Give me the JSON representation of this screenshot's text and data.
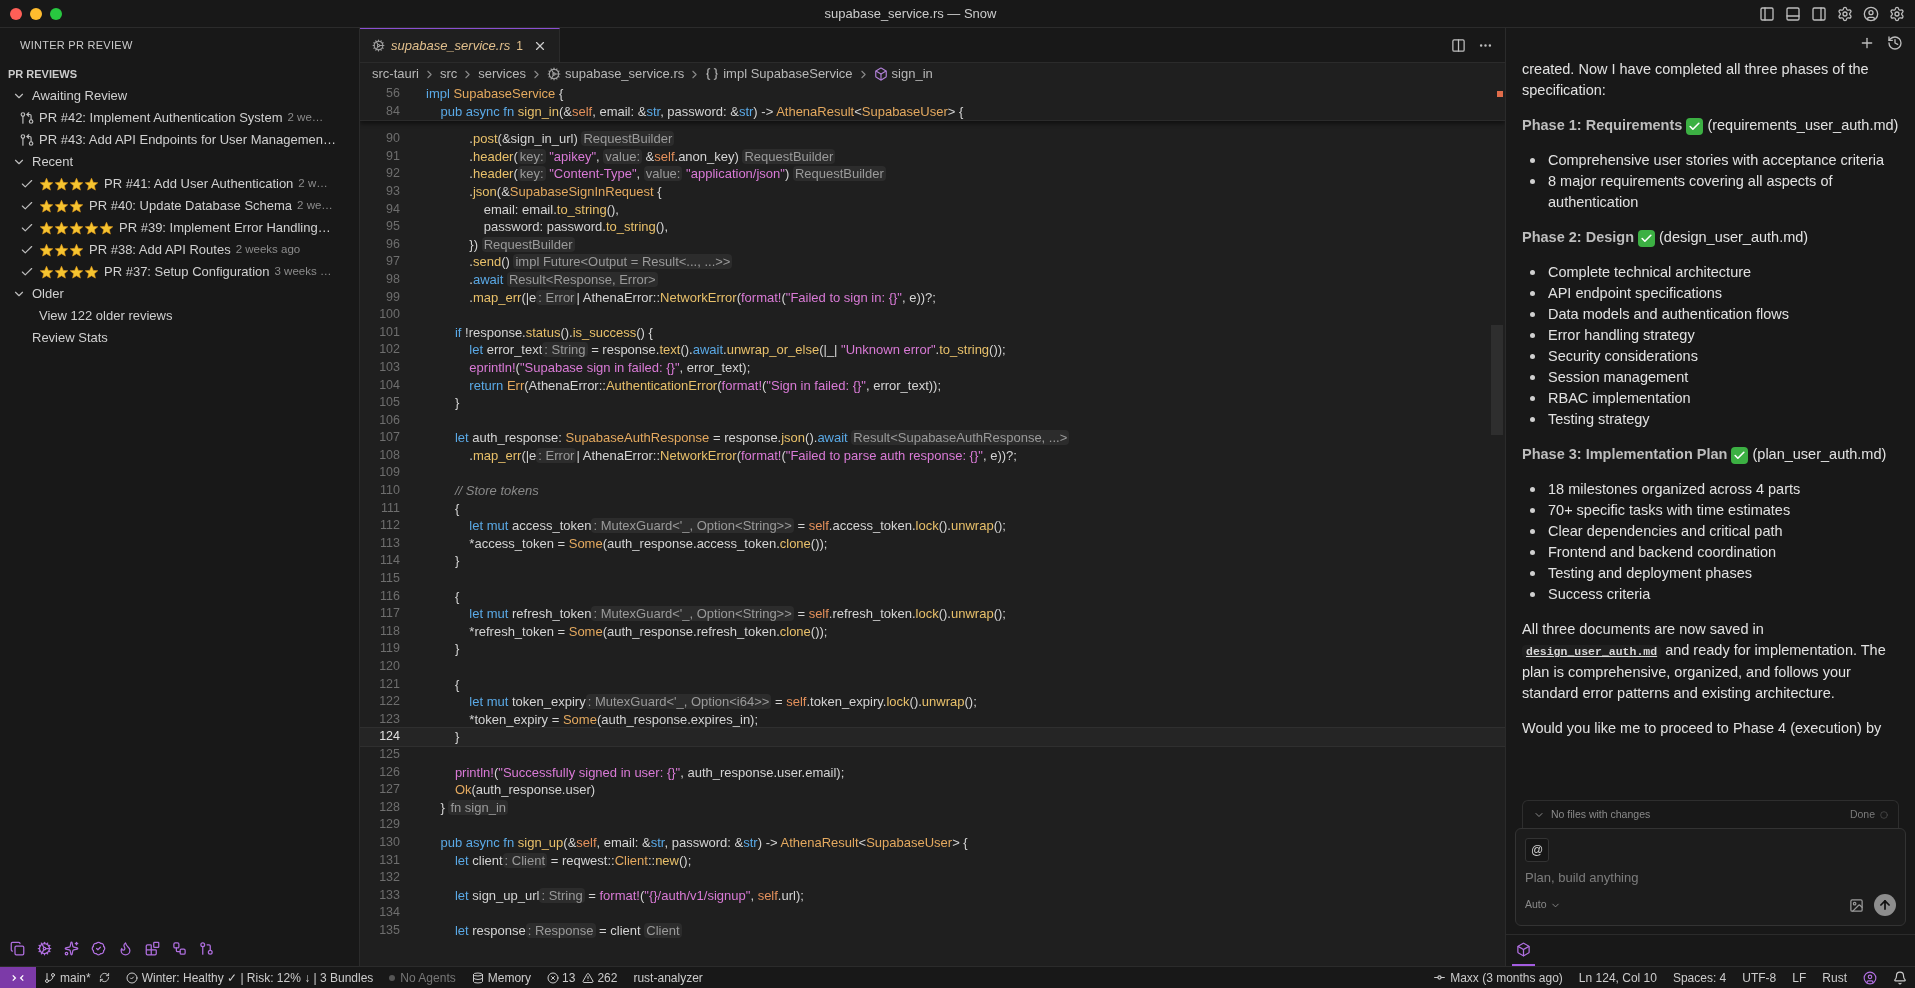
{
  "window": {
    "title": "supabase_service.rs — Snow"
  },
  "sidebar": {
    "title": "WINTER PR REVIEW",
    "section": "PR REVIEWS",
    "groups": [
      {
        "label": "Awaiting Review",
        "expanded": true,
        "children": [
          {
            "kind": "pr",
            "title": "PR #42: Implement Authentication System",
            "age": "2 we…"
          },
          {
            "kind": "pr",
            "title": "PR #43: Add API Endpoints for User Managemen…"
          }
        ]
      },
      {
        "label": "Recent",
        "expanded": true,
        "children": [
          {
            "kind": "rated",
            "stars": 4,
            "title": "PR #41: Add User Authentication",
            "age": "2 w…"
          },
          {
            "kind": "rated",
            "stars": 3,
            "title": "PR #40: Update Database Schema",
            "age": "2 we…"
          },
          {
            "kind": "rated",
            "stars": 5,
            "title": "PR #39: Implement Error Handling…"
          },
          {
            "kind": "rated",
            "stars": 3,
            "title": "PR #38: Add API Routes",
            "age": "2 weeks ago"
          },
          {
            "kind": "rated",
            "stars": 4,
            "title": "PR #37: Setup Configuration",
            "age": "3 weeks …"
          }
        ]
      },
      {
        "label": "Older",
        "expanded": true,
        "children": [
          {
            "kind": "link",
            "title": "View 122 older reviews"
          }
        ]
      }
    ],
    "footer_item": "Review Stats"
  },
  "tab": {
    "name": "supabase_service.rs",
    "problems": "1",
    "selected": true
  },
  "breadcrumbs": [
    {
      "kind": "folder",
      "label": "src-tauri"
    },
    {
      "kind": "folder",
      "label": "src"
    },
    {
      "kind": "folder",
      "label": "services"
    },
    {
      "kind": "file",
      "label": "supabase_service.rs"
    },
    {
      "kind": "impl",
      "label": "impl SupabaseService"
    },
    {
      "kind": "method",
      "label": "sign_in"
    }
  ],
  "code": {
    "sticky_lines": [
      {
        "number": "56",
        "current": false,
        "tokens": [
          {
            "text": "impl ",
            "kind": "kw"
          },
          {
            "text": "SupabaseService ",
            "kind": "ty"
          },
          {
            "text": "{",
            "kind": "p"
          }
        ]
      },
      {
        "number": "84",
        "current": false,
        "tokens": [
          {
            "text": "    pub async fn ",
            "kind": "kw"
          },
          {
            "text": "sign_in",
            "kind": "fn"
          },
          {
            "text": "(&",
            "kind": "p"
          },
          {
            "text": "self",
            "kind": "self"
          },
          {
            "text": ", email: &",
            "kind": "p"
          },
          {
            "text": "str",
            "kind": "kw"
          },
          {
            "text": ", password: &",
            "kind": "p"
          },
          {
            "text": "str",
            "kind": "kw"
          },
          {
            "text": ") -> ",
            "kind": "p"
          },
          {
            "text": "AthenaResult",
            "kind": "ty"
          },
          {
            "text": "<",
            "kind": "p"
          },
          {
            "text": "SupabaseUser",
            "kind": "ty"
          },
          {
            "text": "> {",
            "kind": "p"
          }
        ]
      }
    ],
    "lines": [
      {
        "number": "90",
        "current": false,
        "tokens": [
          {
            "text": "            .",
            "kind": "p"
          },
          {
            "text": "post",
            "kind": "fn"
          },
          {
            "text": "(&sign_in_url) ",
            "kind": "p"
          },
          {
            "text": "RequestBuilder",
            "kind": "hint"
          }
        ]
      },
      {
        "number": "91",
        "current": false,
        "tokens": [
          {
            "text": "            .",
            "kind": "p"
          },
          {
            "text": "header",
            "kind": "fn"
          },
          {
            "text": "(",
            "kind": "p"
          },
          {
            "text": "key:",
            "kind": "hint"
          },
          {
            "text": " \"apikey\"",
            "kind": "str"
          },
          {
            "text": ", ",
            "kind": "p"
          },
          {
            "text": "value:",
            "kind": "hint"
          },
          {
            "text": " &",
            "kind": "p"
          },
          {
            "text": "self",
            "kind": "self"
          },
          {
            "text": ".anon_key) ",
            "kind": "p"
          },
          {
            "text": "RequestBuilder",
            "kind": "hint"
          }
        ]
      },
      {
        "number": "92",
        "current": false,
        "tokens": [
          {
            "text": "            .",
            "kind": "p"
          },
          {
            "text": "header",
            "kind": "fn"
          },
          {
            "text": "(",
            "kind": "p"
          },
          {
            "text": "key:",
            "kind": "hint"
          },
          {
            "text": " \"Content-Type\"",
            "kind": "str"
          },
          {
            "text": ", ",
            "kind": "p"
          },
          {
            "text": "value:",
            "kind": "hint"
          },
          {
            "text": " \"application/json\"",
            "kind": "str"
          },
          {
            "text": ") ",
            "kind": "p"
          },
          {
            "text": "RequestBuilder",
            "kind": "hint"
          }
        ]
      },
      {
        "number": "93",
        "current": false,
        "tokens": [
          {
            "text": "            .",
            "kind": "p"
          },
          {
            "text": "json",
            "kind": "fn"
          },
          {
            "text": "(&",
            "kind": "p"
          },
          {
            "text": "SupabaseSignInRequest",
            "kind": "ty"
          },
          {
            "text": " {",
            "kind": "p"
          }
        ]
      },
      {
        "number": "94",
        "current": false,
        "tokens": [
          {
            "text": "                email: email.",
            "kind": "p"
          },
          {
            "text": "to_string",
            "kind": "fn"
          },
          {
            "text": "(),",
            "kind": "p"
          }
        ]
      },
      {
        "number": "95",
        "current": false,
        "tokens": [
          {
            "text": "                password: password.",
            "kind": "p"
          },
          {
            "text": "to_string",
            "kind": "fn"
          },
          {
            "text": "(),",
            "kind": "p"
          }
        ]
      },
      {
        "number": "96",
        "current": false,
        "tokens": [
          {
            "text": "            }) ",
            "kind": "p"
          },
          {
            "text": "RequestBuilder",
            "kind": "hint"
          }
        ]
      },
      {
        "number": "97",
        "current": false,
        "tokens": [
          {
            "text": "            .",
            "kind": "p"
          },
          {
            "text": "send",
            "kind": "fn"
          },
          {
            "text": "() ",
            "kind": "p"
          },
          {
            "text": "impl Future<Output = Result<..., ...>>",
            "kind": "hint"
          }
        ]
      },
      {
        "number": "98",
        "current": false,
        "tokens": [
          {
            "text": "            .",
            "kind": "p"
          },
          {
            "text": "await ",
            "kind": "kw"
          },
          {
            "text": "Result<Response, Error>",
            "kind": "hint"
          }
        ]
      },
      {
        "number": "99",
        "current": false,
        "tokens": [
          {
            "text": "            .",
            "kind": "p"
          },
          {
            "text": "map_err",
            "kind": "fn"
          },
          {
            "text": "(|e",
            "kind": "p"
          },
          {
            "text": ": Error",
            "kind": "hint"
          },
          {
            "text": "| AthenaError::",
            "kind": "p"
          },
          {
            "text": "NetworkError",
            "kind": "fn"
          },
          {
            "text": "(",
            "kind": "p"
          },
          {
            "text": "format!",
            "kind": "mac"
          },
          {
            "text": "(",
            "kind": "p"
          },
          {
            "text": "\"Failed to sign in: {}\"",
            "kind": "str"
          },
          {
            "text": ", e))?;",
            "kind": "p"
          }
        ]
      },
      {
        "number": "100",
        "current": false
      },
      {
        "number": "101",
        "current": false,
        "tokens": [
          {
            "text": "        if ",
            "kind": "kw"
          },
          {
            "text": "!response.",
            "kind": "p"
          },
          {
            "text": "status",
            "kind": "fn"
          },
          {
            "text": "().",
            "kind": "p"
          },
          {
            "text": "is_success",
            "kind": "fn"
          },
          {
            "text": "() {",
            "kind": "p"
          }
        ]
      },
      {
        "number": "102",
        "current": false,
        "tokens": [
          {
            "text": "            let ",
            "kind": "kw"
          },
          {
            "text": "error_text",
            "kind": "p"
          },
          {
            "text": ": String",
            "kind": "hint"
          },
          {
            "text": " = response.",
            "kind": "p"
          },
          {
            "text": "text",
            "kind": "fn"
          },
          {
            "text": "().",
            "kind": "p"
          },
          {
            "text": "await",
            "kind": "kw"
          },
          {
            "text": ".",
            "kind": "p"
          },
          {
            "text": "unwrap_or_else",
            "kind": "fn"
          },
          {
            "text": "(|_| ",
            "kind": "p"
          },
          {
            "text": "\"Unknown error\"",
            "kind": "str"
          },
          {
            "text": ".",
            "kind": "p"
          },
          {
            "text": "to_string",
            "kind": "fn"
          },
          {
            "text": "());",
            "kind": "p"
          }
        ]
      },
      {
        "number": "103",
        "current": false,
        "tokens": [
          {
            "text": "            eprintln!",
            "kind": "mac"
          },
          {
            "text": "(",
            "kind": "p"
          },
          {
            "text": "\"Supabase sign in failed: {}\"",
            "kind": "str"
          },
          {
            "text": ", error_text);",
            "kind": "p"
          }
        ]
      },
      {
        "number": "104",
        "current": false,
        "tokens": [
          {
            "text": "            return ",
            "kind": "kw"
          },
          {
            "text": "Err",
            "kind": "ty"
          },
          {
            "text": "(AthenaError::",
            "kind": "p"
          },
          {
            "text": "AuthenticationError",
            "kind": "fn"
          },
          {
            "text": "(",
            "kind": "p"
          },
          {
            "text": "format!",
            "kind": "mac"
          },
          {
            "text": "(",
            "kind": "p"
          },
          {
            "text": "\"Sign in failed: {}\"",
            "kind": "str"
          },
          {
            "text": ", error_text));",
            "kind": "p"
          }
        ]
      },
      {
        "number": "105",
        "current": false,
        "tokens": [
          {
            "text": "        }",
            "kind": "p"
          }
        ]
      },
      {
        "number": "106",
        "current": false
      },
      {
        "number": "107",
        "current": false,
        "tokens": [
          {
            "text": "        let ",
            "kind": "kw"
          },
          {
            "text": "auth_response: ",
            "kind": "p"
          },
          {
            "text": "SupabaseAuthResponse",
            "kind": "ty"
          },
          {
            "text": " = response.",
            "kind": "p"
          },
          {
            "text": "json",
            "kind": "fn"
          },
          {
            "text": "().",
            "kind": "p"
          },
          {
            "text": "await ",
            "kind": "kw"
          },
          {
            "text": "Result<SupabaseAuthResponse, ...>",
            "kind": "hint"
          }
        ]
      },
      {
        "number": "108",
        "current": false,
        "tokens": [
          {
            "text": "            .",
            "kind": "p"
          },
          {
            "text": "map_err",
            "kind": "fn"
          },
          {
            "text": "(|e",
            "kind": "p"
          },
          {
            "text": ": Error",
            "kind": "hint"
          },
          {
            "text": "| AthenaError::",
            "kind": "p"
          },
          {
            "text": "NetworkError",
            "kind": "fn"
          },
          {
            "text": "(",
            "kind": "p"
          },
          {
            "text": "format!",
            "kind": "mac"
          },
          {
            "text": "(",
            "kind": "p"
          },
          {
            "text": "\"Failed to parse auth response: {}\"",
            "kind": "str"
          },
          {
            "text": ", e))?;",
            "kind": "p"
          }
        ]
      },
      {
        "number": "109",
        "current": false
      },
      {
        "number": "110",
        "current": false,
        "tokens": [
          {
            "text": "        // Store tokens",
            "kind": "cm"
          }
        ]
      },
      {
        "number": "111",
        "current": false,
        "tokens": [
          {
            "text": "        {",
            "kind": "p"
          }
        ]
      },
      {
        "number": "112",
        "current": false,
        "tokens": [
          {
            "text": "            let mut ",
            "kind": "kw"
          },
          {
            "text": "access_token",
            "kind": "p"
          },
          {
            "text": ": MutexGuard<'_, Option<String>>",
            "kind": "hint"
          },
          {
            "text": " = ",
            "kind": "p"
          },
          {
            "text": "self",
            "kind": "self"
          },
          {
            "text": ".access_token.",
            "kind": "p"
          },
          {
            "text": "lock",
            "kind": "fn"
          },
          {
            "text": "().",
            "kind": "p"
          },
          {
            "text": "unwrap",
            "kind": "fn"
          },
          {
            "text": "();",
            "kind": "p"
          }
        ]
      },
      {
        "number": "113",
        "current": false,
        "tokens": [
          {
            "text": "            *access_token = ",
            "kind": "p"
          },
          {
            "text": "Some",
            "kind": "ty"
          },
          {
            "text": "(auth_response.access_token.",
            "kind": "p"
          },
          {
            "text": "clone",
            "kind": "fn"
          },
          {
            "text": "());",
            "kind": "p"
          }
        ]
      },
      {
        "number": "114",
        "current": false,
        "tokens": [
          {
            "text": "        }",
            "kind": "p"
          }
        ]
      },
      {
        "number": "115",
        "current": false
      },
      {
        "number": "116",
        "current": false,
        "tokens": [
          {
            "text": "        {",
            "kind": "p"
          }
        ]
      },
      {
        "number": "117",
        "current": false,
        "tokens": [
          {
            "text": "            let mut ",
            "kind": "kw"
          },
          {
            "text": "refresh_token",
            "kind": "p"
          },
          {
            "text": ": MutexGuard<'_, Option<String>>",
            "kind": "hint"
          },
          {
            "text": " = ",
            "kind": "p"
          },
          {
            "text": "self",
            "kind": "self"
          },
          {
            "text": ".refresh_token.",
            "kind": "p"
          },
          {
            "text": "lock",
            "kind": "fn"
          },
          {
            "text": "().",
            "kind": "p"
          },
          {
            "text": "unwrap",
            "kind": "fn"
          },
          {
            "text": "();",
            "kind": "p"
          }
        ]
      },
      {
        "number": "118",
        "current": false,
        "tokens": [
          {
            "text": "            *refresh_token = ",
            "kind": "p"
          },
          {
            "text": "Some",
            "kind": "ty"
          },
          {
            "text": "(auth_response.refresh_token.",
            "kind": "p"
          },
          {
            "text": "clone",
            "kind": "fn"
          },
          {
            "text": "());",
            "kind": "p"
          }
        ]
      },
      {
        "number": "119",
        "current": false,
        "tokens": [
          {
            "text": "        }",
            "kind": "p"
          }
        ]
      },
      {
        "number": "120",
        "current": false
      },
      {
        "number": "121",
        "current": false,
        "tokens": [
          {
            "text": "        {",
            "kind": "p"
          }
        ]
      },
      {
        "number": "122",
        "current": false,
        "tokens": [
          {
            "text": "            let mut ",
            "kind": "kw"
          },
          {
            "text": "token_expiry",
            "kind": "p"
          },
          {
            "text": ": MutexGuard<'_, Option<i64>>",
            "kind": "hint"
          },
          {
            "text": " = ",
            "kind": "p"
          },
          {
            "text": "self",
            "kind": "self"
          },
          {
            "text": ".token_expiry.",
            "kind": "p"
          },
          {
            "text": "lock",
            "kind": "fn"
          },
          {
            "text": "().",
            "kind": "p"
          },
          {
            "text": "unwrap",
            "kind": "fn"
          },
          {
            "text": "();",
            "kind": "p"
          }
        ]
      },
      {
        "number": "123",
        "current": false,
        "tokens": [
          {
            "text": "            *token_expiry = ",
            "kind": "p"
          },
          {
            "text": "Some",
            "kind": "ty"
          },
          {
            "text": "(auth_response.expires_in);",
            "kind": "p"
          }
        ]
      },
      {
        "number": "124",
        "current": true,
        "tokens": [
          {
            "text": "        }",
            "kind": "p"
          }
        ]
      },
      {
        "number": "125",
        "current": false
      },
      {
        "number": "126",
        "current": false,
        "tokens": [
          {
            "text": "        println!",
            "kind": "mac"
          },
          {
            "text": "(",
            "kind": "p"
          },
          {
            "text": "\"Successfully signed in user: {}\"",
            "kind": "str"
          },
          {
            "text": ", auth_response.user.email);",
            "kind": "p"
          }
        ]
      },
      {
        "number": "127",
        "current": false,
        "tokens": [
          {
            "text": "        Ok",
            "kind": "ty"
          },
          {
            "text": "(auth_response.user)",
            "kind": "p"
          }
        ]
      },
      {
        "number": "128",
        "current": false,
        "tokens": [
          {
            "text": "    } ",
            "kind": "p"
          },
          {
            "text": "fn sign_in",
            "kind": "hint"
          }
        ]
      },
      {
        "number": "129",
        "current": false
      },
      {
        "number": "130",
        "current": false,
        "tokens": [
          {
            "text": "    pub async fn ",
            "kind": "kw"
          },
          {
            "text": "sign_up",
            "kind": "fn"
          },
          {
            "text": "(&",
            "kind": "p"
          },
          {
            "text": "self",
            "kind": "self"
          },
          {
            "text": ", email: &",
            "kind": "p"
          },
          {
            "text": "str",
            "kind": "kw"
          },
          {
            "text": ", password: &",
            "kind": "p"
          },
          {
            "text": "str",
            "kind": "kw"
          },
          {
            "text": ") -> ",
            "kind": "p"
          },
          {
            "text": "AthenaResult",
            "kind": "ty"
          },
          {
            "text": "<",
            "kind": "p"
          },
          {
            "text": "SupabaseUser",
            "kind": "ty"
          },
          {
            "text": "> {",
            "kind": "p"
          }
        ]
      },
      {
        "number": "131",
        "current": false,
        "tokens": [
          {
            "text": "        let ",
            "kind": "kw"
          },
          {
            "text": "client",
            "kind": "p"
          },
          {
            "text": ": Client",
            "kind": "hint"
          },
          {
            "text": " = reqwest::",
            "kind": "p"
          },
          {
            "text": "Client",
            "kind": "ty"
          },
          {
            "text": "::",
            "kind": "p"
          },
          {
            "text": "new",
            "kind": "fn"
          },
          {
            "text": "();",
            "kind": "p"
          }
        ]
      },
      {
        "number": "132",
        "current": false
      },
      {
        "number": "133",
        "current": false,
        "tokens": [
          {
            "text": "        let ",
            "kind": "kw"
          },
          {
            "text": "sign_up_url",
            "kind": "p"
          },
          {
            "text": ": String",
            "kind": "hint"
          },
          {
            "text": " = ",
            "kind": "p"
          },
          {
            "text": "format!",
            "kind": "mac"
          },
          {
            "text": "(",
            "kind": "p"
          },
          {
            "text": "\"{}/auth/v1/signup\"",
            "kind": "str"
          },
          {
            "text": ", ",
            "kind": "p"
          },
          {
            "text": "self",
            "kind": "self"
          },
          {
            "text": ".url);",
            "kind": "p"
          }
        ]
      },
      {
        "number": "134",
        "current": false
      },
      {
        "number": "135",
        "current": false,
        "tokens": [
          {
            "text": "        let ",
            "kind": "kw"
          },
          {
            "text": "response",
            "kind": "p"
          },
          {
            "text": ": Response",
            "kind": "hint"
          },
          {
            "text": " = client ",
            "kind": "p"
          },
          {
            "text": "Client",
            "kind": "hint"
          }
        ]
      }
    ]
  },
  "chat": {
    "blocks": [
      {
        "kind": "paragraph",
        "parts": [
          {
            "text": "created. Now I have completed all three phases of the specification:"
          }
        ]
      },
      {
        "kind": "heading",
        "title": "Phase 1: Requirements",
        "file": "(requirements_user_auth.md)"
      },
      {
        "kind": "list",
        "items": [
          "Comprehensive user stories with acceptance criteria",
          "8 major requirements covering all aspects of authentication"
        ]
      },
      {
        "kind": "heading",
        "title": "Phase 2: Design",
        "file": "(design_user_auth.md)"
      },
      {
        "kind": "list",
        "items": [
          "Complete technical architecture",
          "API endpoint specifications",
          "Data models and authentication flows",
          "Error handling strategy",
          "Security considerations",
          "Session management",
          "RBAC implementation",
          "Testing strategy"
        ]
      },
      {
        "kind": "heading",
        "title": "Phase 3: Implementation Plan",
        "file": "(plan_user_auth.md)"
      },
      {
        "kind": "list",
        "items": [
          "18 milestones organized across 4 parts",
          "70+ specific tasks with time estimates",
          "Clear dependencies and critical path",
          "Frontend and backend coordination",
          "Testing and deployment phases",
          "Success criteria"
        ]
      },
      {
        "kind": "paragraph",
        "parts": [
          {
            "text": "All three documents are now saved in "
          },
          {
            "code": "design_user_auth.md"
          },
          {
            "text": " and ready for implementation. The plan is comprehensive, organized, and follows your standard error patterns and existing architecture."
          }
        ]
      },
      {
        "kind": "paragraph",
        "parts": [
          {
            "text": "Would you like me to proceed to Phase 4 (execution) by"
          }
        ]
      }
    ],
    "changes": "No files with changes",
    "done": "Done",
    "mention": "@",
    "placeholder": "Plan, build anything",
    "mode": "Auto"
  },
  "status_bar": {
    "branch": "main*",
    "health": "Winter: Healthy ✓ | Risk: 12% ↓ | 3 Bundles",
    "agents": "No Agents",
    "memory": "Memory",
    "errors": "13",
    "warnings": "262",
    "language_server": "rust-analyzer",
    "blame": "Maxx (3 months ago)",
    "position": "Ln 124, Col 10",
    "spaces": "Spaces: 4",
    "encoding": "UTF-8",
    "eol": "LF",
    "language": "Rust"
  }
}
